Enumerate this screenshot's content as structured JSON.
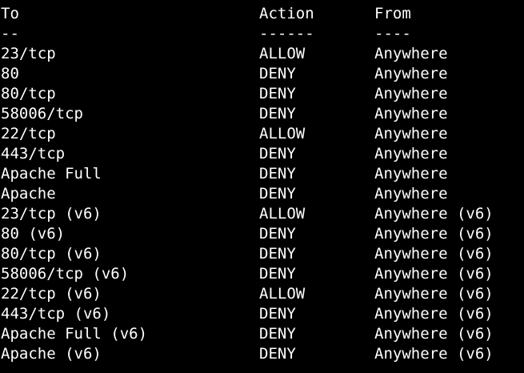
{
  "header": {
    "to": "To",
    "action": "Action",
    "from": "From"
  },
  "separator": {
    "to": "--",
    "action": "------",
    "from": "----"
  },
  "rules": [
    {
      "to": "23/tcp",
      "action": "ALLOW",
      "from": "Anywhere"
    },
    {
      "to": "80",
      "action": "DENY",
      "from": "Anywhere"
    },
    {
      "to": "80/tcp",
      "action": "DENY",
      "from": "Anywhere"
    },
    {
      "to": "58006/tcp",
      "action": "DENY",
      "from": "Anywhere"
    },
    {
      "to": "22/tcp",
      "action": "ALLOW",
      "from": "Anywhere"
    },
    {
      "to": "443/tcp",
      "action": "DENY",
      "from": "Anywhere"
    },
    {
      "to": "Apache Full",
      "action": "DENY",
      "from": "Anywhere"
    },
    {
      "to": "Apache",
      "action": "DENY",
      "from": "Anywhere"
    },
    {
      "to": "23/tcp (v6)",
      "action": "ALLOW",
      "from": "Anywhere (v6)"
    },
    {
      "to": "80 (v6)",
      "action": "DENY",
      "from": "Anywhere (v6)"
    },
    {
      "to": "80/tcp (v6)",
      "action": "DENY",
      "from": "Anywhere (v6)"
    },
    {
      "to": "58006/tcp (v6)",
      "action": "DENY",
      "from": "Anywhere (v6)"
    },
    {
      "to": "22/tcp (v6)",
      "action": "ALLOW",
      "from": "Anywhere (v6)"
    },
    {
      "to": "443/tcp (v6)",
      "action": "DENY",
      "from": "Anywhere (v6)"
    },
    {
      "to": "Apache Full (v6)",
      "action": "DENY",
      "from": "Anywhere (v6)"
    },
    {
      "to": "Apache (v6)",
      "action": "DENY",
      "from": "Anywhere (v6)"
    }
  ]
}
